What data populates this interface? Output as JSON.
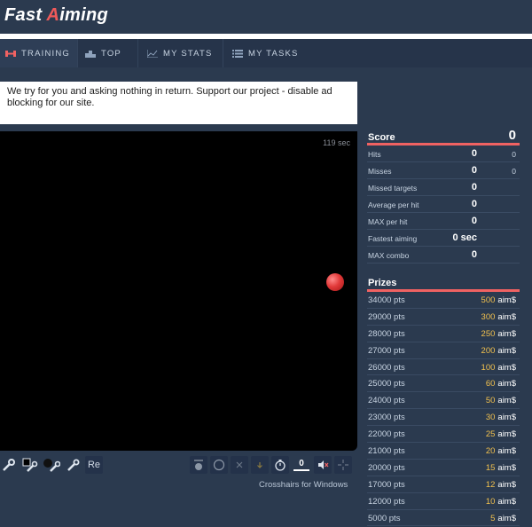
{
  "header": {
    "logo_first": "Fast ",
    "logo_accent_letter": "A",
    "logo_rest": "iming"
  },
  "nav": [
    {
      "label": "TRAINING",
      "icon": "flag-icon"
    },
    {
      "label": "TOP",
      "icon": "podium-icon"
    },
    {
      "label": "MY STATS",
      "icon": "chart-icon"
    },
    {
      "label": "MY TASKS",
      "icon": "list-icon"
    }
  ],
  "notice": {
    "text": "We try for you and asking nothing in return. Support our project - disable ad blocking for our site."
  },
  "game": {
    "timer": "119 sec"
  },
  "toolbar": {
    "reset_label": "Re",
    "target_count": "0"
  },
  "crosshair_link": "Crosshairs for Windows",
  "score": {
    "label": "Score",
    "value": "0",
    "rows": [
      {
        "label": "Hits",
        "value": "0",
        "extra": "0"
      },
      {
        "label": "Misses",
        "value": "0",
        "extra": "0"
      },
      {
        "label": "Missed targets",
        "value": "0",
        "extra": ""
      },
      {
        "label": "Average per hit",
        "value": "0",
        "extra": ""
      },
      {
        "label": "MAX per hit",
        "value": "0",
        "extra": ""
      },
      {
        "label": "Fastest aiming",
        "value": "0 sec",
        "extra": ""
      },
      {
        "label": "MAX combo",
        "value": "0",
        "extra": ""
      }
    ]
  },
  "prizes": {
    "label": "Prizes",
    "unit": "aim$",
    "rows": [
      {
        "pts": "34000 pts",
        "amount": "500"
      },
      {
        "pts": "29000 pts",
        "amount": "300"
      },
      {
        "pts": "28000 pts",
        "amount": "250"
      },
      {
        "pts": "27000 pts",
        "amount": "200"
      },
      {
        "pts": "26000 pts",
        "amount": "100"
      },
      {
        "pts": "25000 pts",
        "amount": "60"
      },
      {
        "pts": "24000 pts",
        "amount": "50"
      },
      {
        "pts": "23000 pts",
        "amount": "30"
      },
      {
        "pts": "22000 pts",
        "amount": "25"
      },
      {
        "pts": "21000 pts",
        "amount": "20"
      },
      {
        "pts": "20000 pts",
        "amount": "15"
      },
      {
        "pts": "17000 pts",
        "amount": "12"
      },
      {
        "pts": "12000 pts",
        "amount": "10"
      },
      {
        "pts": "5000 pts",
        "amount": "5"
      }
    ]
  },
  "colors": {
    "accent": "#f06262",
    "background": "#2b3a4f",
    "prize_amount": "#f2c14e",
    "target": "#e23a3a"
  }
}
